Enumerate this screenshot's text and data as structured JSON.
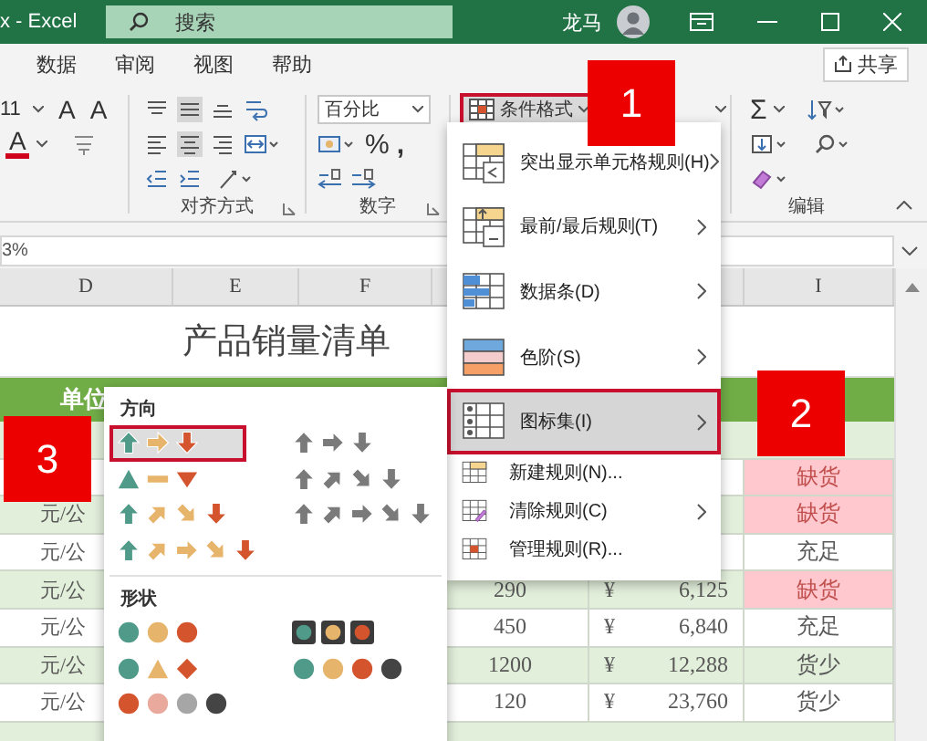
{
  "title_bar": {
    "file_name": "x - Excel",
    "search_placeholder": "搜索",
    "user": "龙马"
  },
  "tabs": [
    "数据",
    "审阅",
    "视图",
    "帮助"
  ],
  "share_button": "共享",
  "ribbon": {
    "font_size": "11",
    "grow_font": "A",
    "shrink_font": "A",
    "font_color": "A",
    "number_format": "百分比",
    "percent": "%",
    "comma": ",",
    "conditional_format": {
      "label": "条件格式",
      "pressed": true
    },
    "autosum": "Σ",
    "groups": [
      "对齐方式",
      "数字",
      "编辑"
    ]
  },
  "formula_bar": {
    "value": "3%"
  },
  "sheet": {
    "columns": {
      "d": "D",
      "e": "E",
      "f": "F",
      "i": "I"
    },
    "title": "产品销量清单",
    "header_label": "单位",
    "rows": [
      {
        "status": "缺货",
        "alert": true
      },
      {
        "unit": "元/公",
        "status": "缺货",
        "alert": true
      },
      {
        "unit": "元/公",
        "status": "充足",
        "alert": false
      },
      {
        "unit": "元/公",
        "quantity": "290",
        "currency": "¥",
        "amount": "6,125",
        "status": "缺货",
        "alert": true
      },
      {
        "unit": "元/公",
        "quantity": "450",
        "currency": "¥",
        "amount": "6,840",
        "status": "充足",
        "alert": false
      },
      {
        "unit": "元/公",
        "quantity": "1200",
        "currency": "¥",
        "amount": "12,288",
        "status": "货少",
        "alert": false
      },
      {
        "unit": "元/公",
        "quantity": "120",
        "currency": "¥",
        "amount": "23,760",
        "status": "货少",
        "alert": false
      }
    ]
  },
  "menu": {
    "items": [
      {
        "label": "突出显示单元格规则(H)",
        "kind": "highlight",
        "submenu": true,
        "selected": false
      },
      {
        "label": "最前/最后规则(T)",
        "kind": "topbottom",
        "submenu": true,
        "selected": false
      },
      {
        "label": "数据条(D)",
        "kind": "databar",
        "submenu": true,
        "selected": false
      },
      {
        "label": "色阶(S)",
        "kind": "colorscale",
        "submenu": true,
        "selected": false
      },
      {
        "label": "图标集(I)",
        "kind": "iconset",
        "submenu": true,
        "selected": true
      },
      {
        "label": "新建规则(N)...",
        "kind": "new",
        "submenu": false,
        "selected": false
      },
      {
        "label": "清除规则(C)",
        "kind": "clear",
        "submenu": true,
        "selected": false
      },
      {
        "label": "管理规则(R)...",
        "kind": "manage",
        "submenu": false,
        "selected": false
      }
    ]
  },
  "submenu": {
    "sections": [
      {
        "title": "方向",
        "sets": [
          {
            "kind": "arrows3",
            "selected": true
          },
          {
            "kind": "gray3",
            "selected": false
          },
          {
            "kind": "triangles3",
            "selected": false
          },
          {
            "kind": "gray4",
            "selected": false
          },
          {
            "kind": "arrows4",
            "selected": false
          },
          {
            "kind": "gray5",
            "selected": false
          },
          {
            "kind": "arrows5",
            "selected": false
          }
        ]
      },
      {
        "title": "形状",
        "sets": [
          {
            "kind": "traffic3",
            "selected": false
          },
          {
            "kind": "framed3",
            "selected": false
          },
          {
            "kind": "signs3",
            "selected": false
          },
          {
            "kind": "traffic4",
            "selected": false
          },
          {
            "kind": "ratings4",
            "selected": false
          }
        ]
      }
    ]
  },
  "callouts": [
    "1",
    "2",
    "3"
  ]
}
